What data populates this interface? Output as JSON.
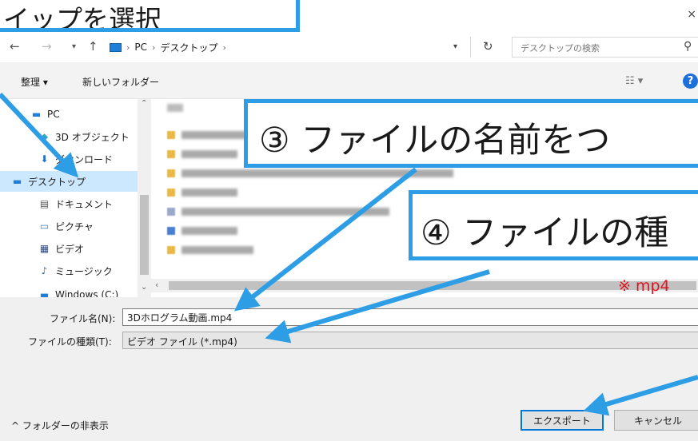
{
  "callouts": {
    "top_left": "イップを選択",
    "step3": "③ ファイルの名前をつ",
    "step4": "④ ファイルの種",
    "note": "※ mp4"
  },
  "window": {
    "close_glyph": "×"
  },
  "address": {
    "crumbs": [
      "PC",
      "デスクトップ"
    ],
    "search_placeholder": "デスクトップの検索"
  },
  "commandbar": {
    "organize": "整理 ▾",
    "new_folder": "新しいフォルダー"
  },
  "nav": {
    "items": [
      {
        "label": "PC",
        "icon": "pc-icon"
      },
      {
        "label": "3D オブジェクト",
        "icon": "3d-objects-icon"
      },
      {
        "label": "ダウンロード",
        "icon": "download-icon"
      },
      {
        "label": "デスクトップ",
        "icon": "desktop-icon",
        "selected": true
      },
      {
        "label": "ドキュメント",
        "icon": "document-icon"
      },
      {
        "label": "ピクチャ",
        "icon": "pictures-icon"
      },
      {
        "label": "ビデオ",
        "icon": "video-icon"
      },
      {
        "label": "ミュージック",
        "icon": "music-icon"
      },
      {
        "label": "Windows (C:)",
        "icon": "drive-icon"
      }
    ]
  },
  "form": {
    "filename_label": "ファイル名(N):",
    "filename_value": "3Dホログラム動画.mp4",
    "filetype_label": "ファイルの種類(T):",
    "filetype_value": "ビデオ ファイル (*.mp4)"
  },
  "footer": {
    "hide_folders": "^ フォルダーの非表示",
    "export": "エクスポート",
    "cancel": "キャンセル"
  },
  "colors": {
    "callout_border": "#2d9de5",
    "selected_bg": "#cce8ff",
    "note_red": "#e0141e",
    "accent": "#0078d7"
  }
}
